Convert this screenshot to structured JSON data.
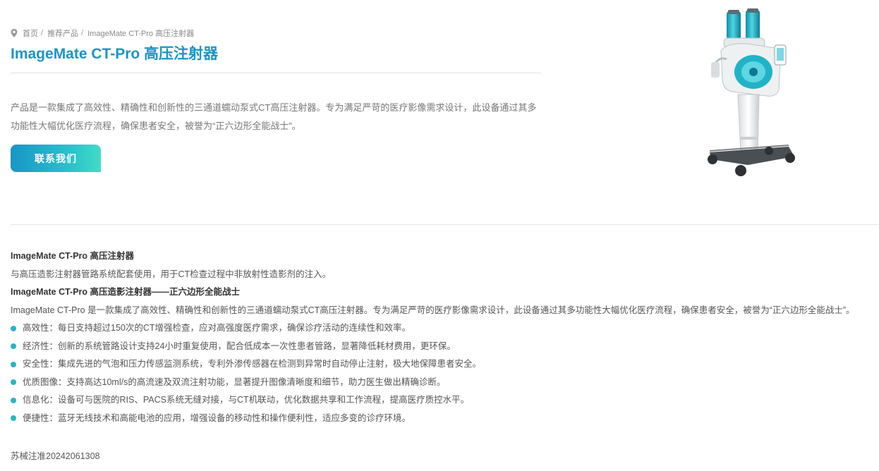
{
  "breadcrumb": {
    "icon": "location-pin-icon",
    "items": [
      "首页",
      "推荐产品",
      "ImageMate CT-Pro 高压注射器"
    ],
    "separator": "/"
  },
  "product": {
    "title": "ImageMate CT-Pro 高压注射器",
    "intro": "产品是一款集成了高效性、精确性和创新性的三通道蠕动泵式CT高压注射器。专为满足严苛的医疗影像需求设计，此设备通过其多功能性大幅优化医疗流程，确保患者安全，被誉为“正六边形全能战士”。",
    "contact_button": "联系我们",
    "image_name": "ct-injector-product-image"
  },
  "detail": {
    "heading1": "ImageMate CT-Pro 高压注射器",
    "line1": "与高压造影注射器管路系统配套使用，用于CT检查过程中非放射性造影剂的注入。",
    "heading2": "ImageMate CT-Pro 高压造影注射器——正六边形全能战士",
    "line2": "ImageMate CT-Pro 是一款集成了高效性、精确性和创新性的三通道蠕动泵式CT高压注射器。专为满足严苛的医疗影像需求设计，此设备通过其多功能性大幅优化医疗流程，确保患者安全，被誉为“正六边形全能战士”。",
    "features": [
      "高效性：每日支持超过150次的CT增强检查，应对高强度医疗需求，确保诊疗活动的连续性和效率。",
      "经济性：创新的系统管路设计支持24小时重复使用，配合低成本一次性患者管路，显著降低耗材费用，更环保。",
      "安全性：集成先进的气泡和压力传感监测系统，专利外渗传感器在检测到异常时自动停止注射，极大地保障患者安全。",
      "优质图像：支持高达10ml/s的高流速及双流注射功能，显著提升图像清晰度和细节，助力医生做出精确诊断。",
      "信息化：设备可与医院的RIS、PACS系统无缝对接，与CT机联动，优化数据共享和工作流程，提高医疗质控水平。",
      "便捷性：蓝牙无线技术和高能电池的应用，增强设备的移动性和操作便利性，适应多变的诊疗环境。"
    ],
    "registration": "苏械注准20242061308"
  },
  "colors": {
    "accent": "#1a95c6",
    "bullet": "#2bb3c2",
    "button_gradient_end": "#43dcc6"
  }
}
